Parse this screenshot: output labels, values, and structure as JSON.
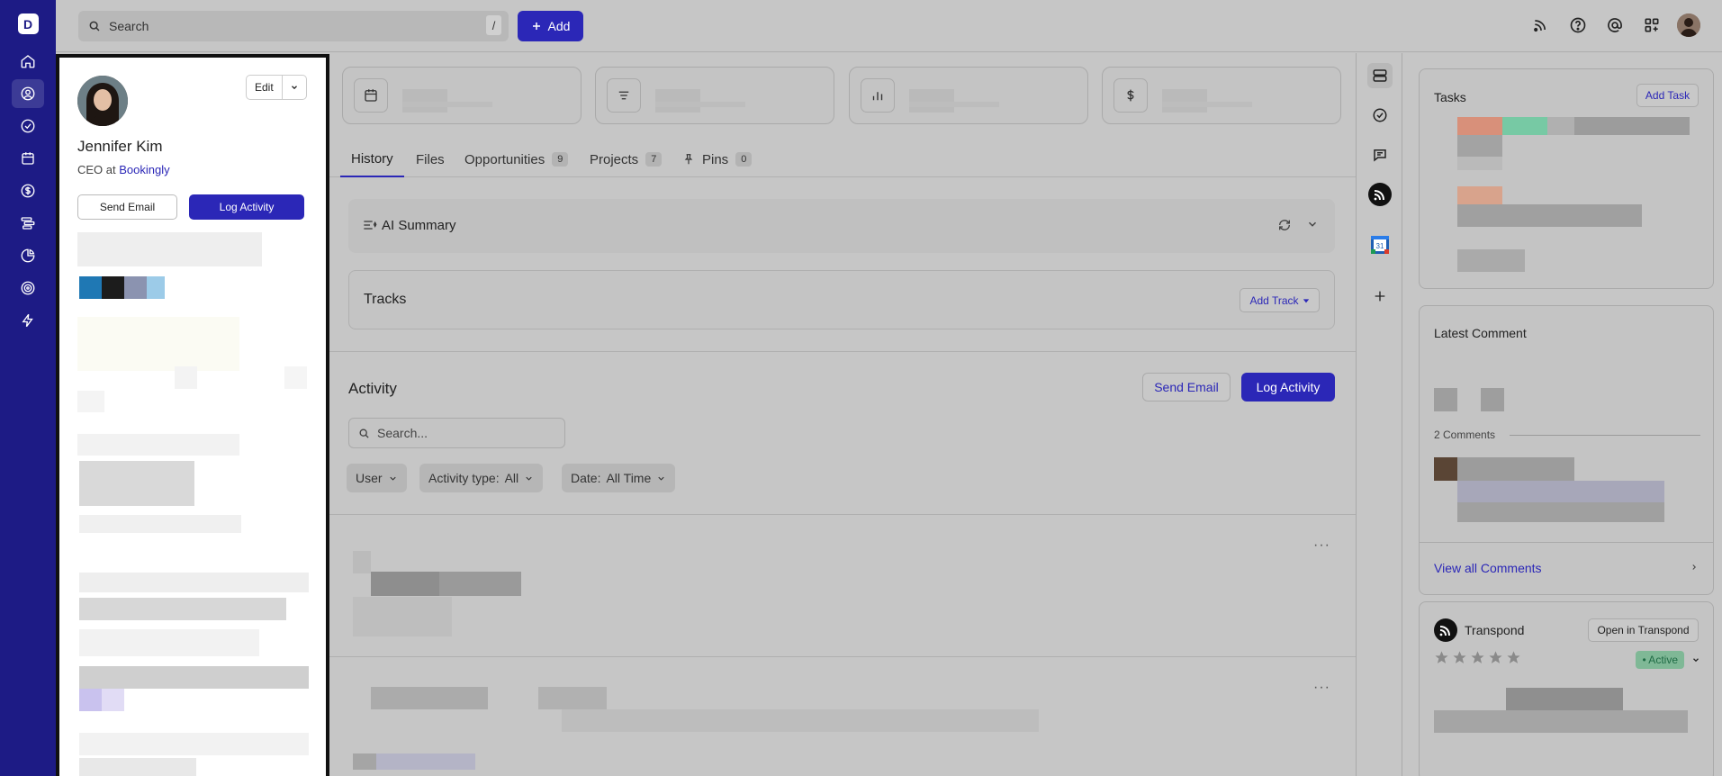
{
  "app": {
    "logo_letter": "D"
  },
  "topbar": {
    "search_placeholder": "Search",
    "search_shortcut": "/",
    "add_label": "Add"
  },
  "profile": {
    "name": "Jennifer Kim",
    "role_prefix": "CEO at",
    "company": "Bookingly",
    "edit_label": "Edit",
    "send_email_label": "Send Email",
    "log_activity_label": "Log Activity"
  },
  "tabs": [
    {
      "label": "History",
      "count": ""
    },
    {
      "label": "Files",
      "count": ""
    },
    {
      "label": "Opportunities",
      "count": "9"
    },
    {
      "label": "Projects",
      "count": "7"
    },
    {
      "label": "Pins",
      "count": "0"
    }
  ],
  "ai_summary": {
    "title": "AI Summary"
  },
  "tracks": {
    "title": "Tracks",
    "add_label": "Add Track"
  },
  "activity": {
    "title": "Activity",
    "send_email_label": "Send Email",
    "log_activity_label": "Log Activity",
    "search_placeholder": "Search...",
    "filters": {
      "user": "User",
      "type_label": "Activity type:",
      "type_value": "All",
      "date_label": "Date:",
      "date_value": "All Time"
    }
  },
  "right": {
    "tasks_title": "Tasks",
    "add_task_label": "Add Task",
    "latest_comment_title": "Latest Comment",
    "comments_count": "2 Comments",
    "view_all_comments": "View all Comments",
    "transpond_title": "Transpond",
    "open_transpond_label": "Open in Transpond",
    "status_label": "• Active",
    "rating": 0
  },
  "colors": {
    "accent": "#2b27b7",
    "nav_bg": "#1d1b85",
    "status_green": "#4caf82"
  },
  "icons": [
    "home-icon",
    "contacts-icon",
    "tasks-icon",
    "calendar-icon",
    "dollar-icon",
    "pipeline-icon",
    "reports-icon",
    "goals-icon",
    "automation-icon",
    "feed-icon",
    "help-icon",
    "mention-icon",
    "apps-icon"
  ]
}
